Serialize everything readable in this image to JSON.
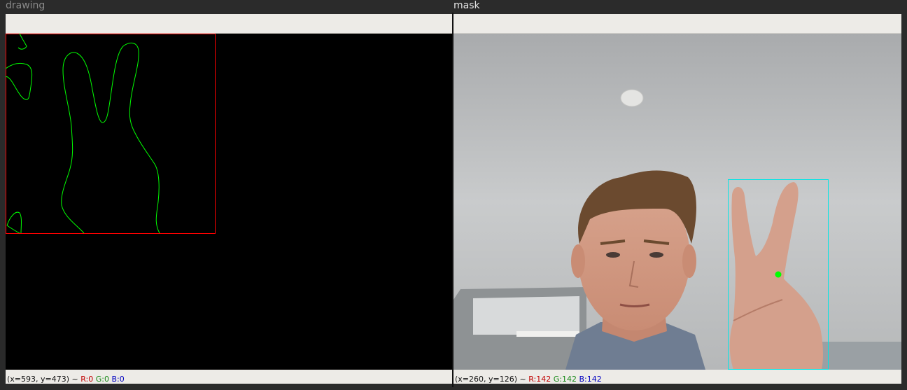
{
  "windows": [
    {
      "title": "drawing",
      "status": {
        "coords": "(x=593, y=473) ~",
        "r": "R:0",
        "g": "G:0",
        "b": "B:0"
      }
    },
    {
      "title": "mask",
      "status": {
        "coords": "(x=260, y=126) ~",
        "r": "R:142",
        "g": "G:142",
        "b": "B:142"
      }
    }
  ],
  "colors": {
    "contour": "#00ff00",
    "bounding_box_drawing": "#ff0000",
    "bounding_box_mask": "#00e5e5",
    "centroid": "#00ff00"
  }
}
